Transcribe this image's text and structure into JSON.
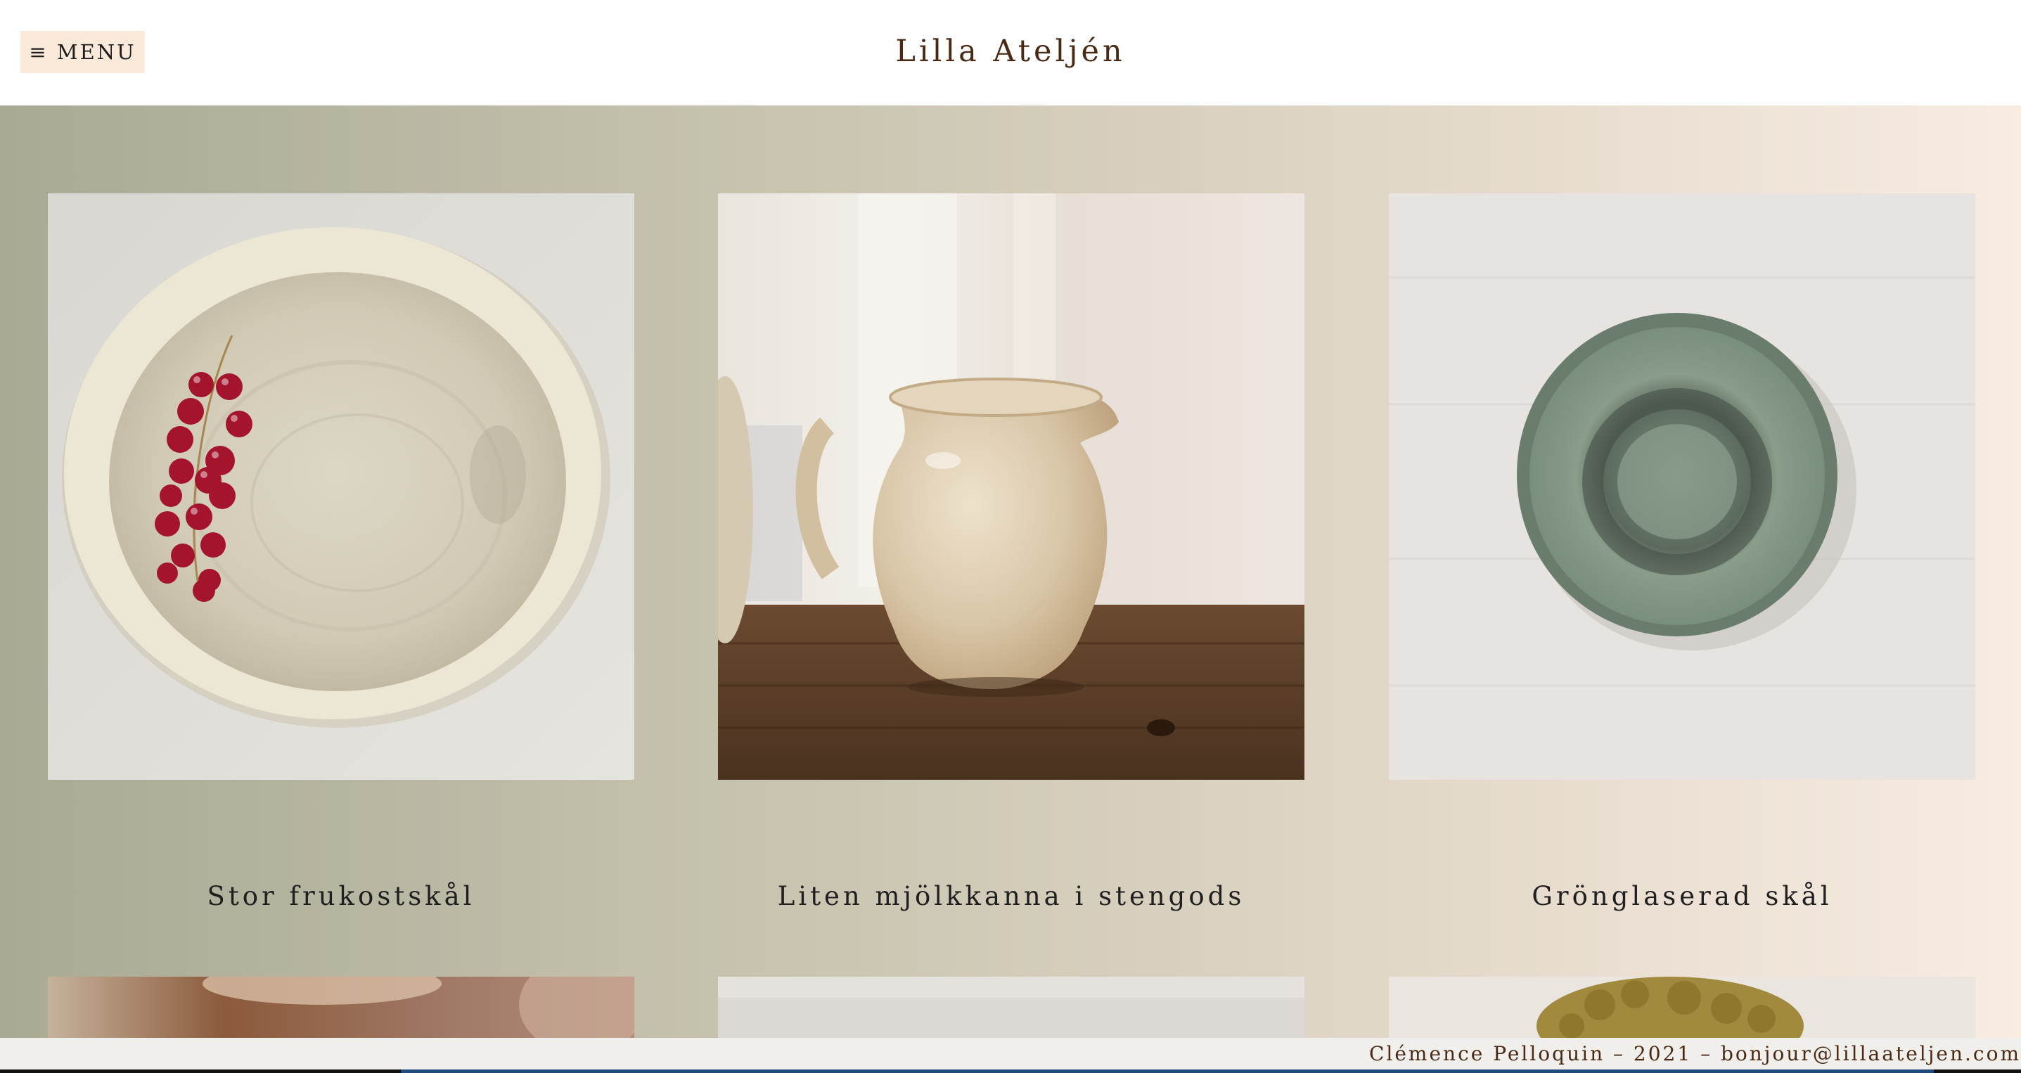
{
  "header": {
    "menu_icon": "hamburger-icon",
    "menu_label": "≡ MENU",
    "site_title": "Lilla Ateljén"
  },
  "products": [
    {
      "name": "Stor frukostskål",
      "image": "bowl-with-red-currants"
    },
    {
      "name": "Liten mjölkkanna i stengods",
      "image": "stoneware-milk-jug"
    },
    {
      "name": "Grönglaserad skål",
      "image": "green-glazed-bowl"
    }
  ],
  "footer": {
    "text": "Clémence Pelloquin – 2021 – bonjour@lillaateljen.com"
  },
  "colors": {
    "accent": "#fbe9d9",
    "title": "#4a2a14",
    "gradient_start": "#a9aa94",
    "gradient_end": "#f8ece3"
  }
}
